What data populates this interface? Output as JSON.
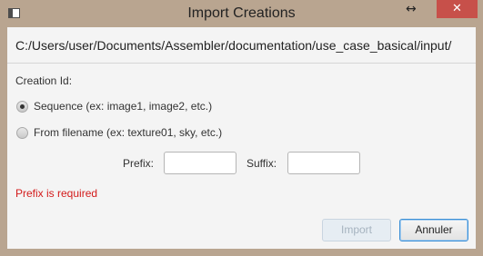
{
  "window": {
    "title": "Import Creations",
    "resize_icon": "↔",
    "close_icon": "✕"
  },
  "path": "C:/Users/user/Documents/Assembler/documentation/use_case_basical/input/",
  "creation_id": {
    "label": "Creation Id:",
    "options": [
      {
        "label": "Sequence (ex: image1, image2, etc.)",
        "checked": true
      },
      {
        "label": "From filename (ex: texture01, sky, etc.)",
        "checked": false
      }
    ]
  },
  "prefix": {
    "label": "Prefix:",
    "value": ""
  },
  "suffix": {
    "label": "Suffix:",
    "value": ""
  },
  "error_text": "Prefix is required",
  "buttons": {
    "import_label": "Import",
    "import_enabled": false,
    "cancel_label": "Annuler"
  },
  "colors": {
    "frame": "#b9a590",
    "close": "#c7504a",
    "error": "#d31b1b",
    "focus": "#3b8fd6"
  }
}
